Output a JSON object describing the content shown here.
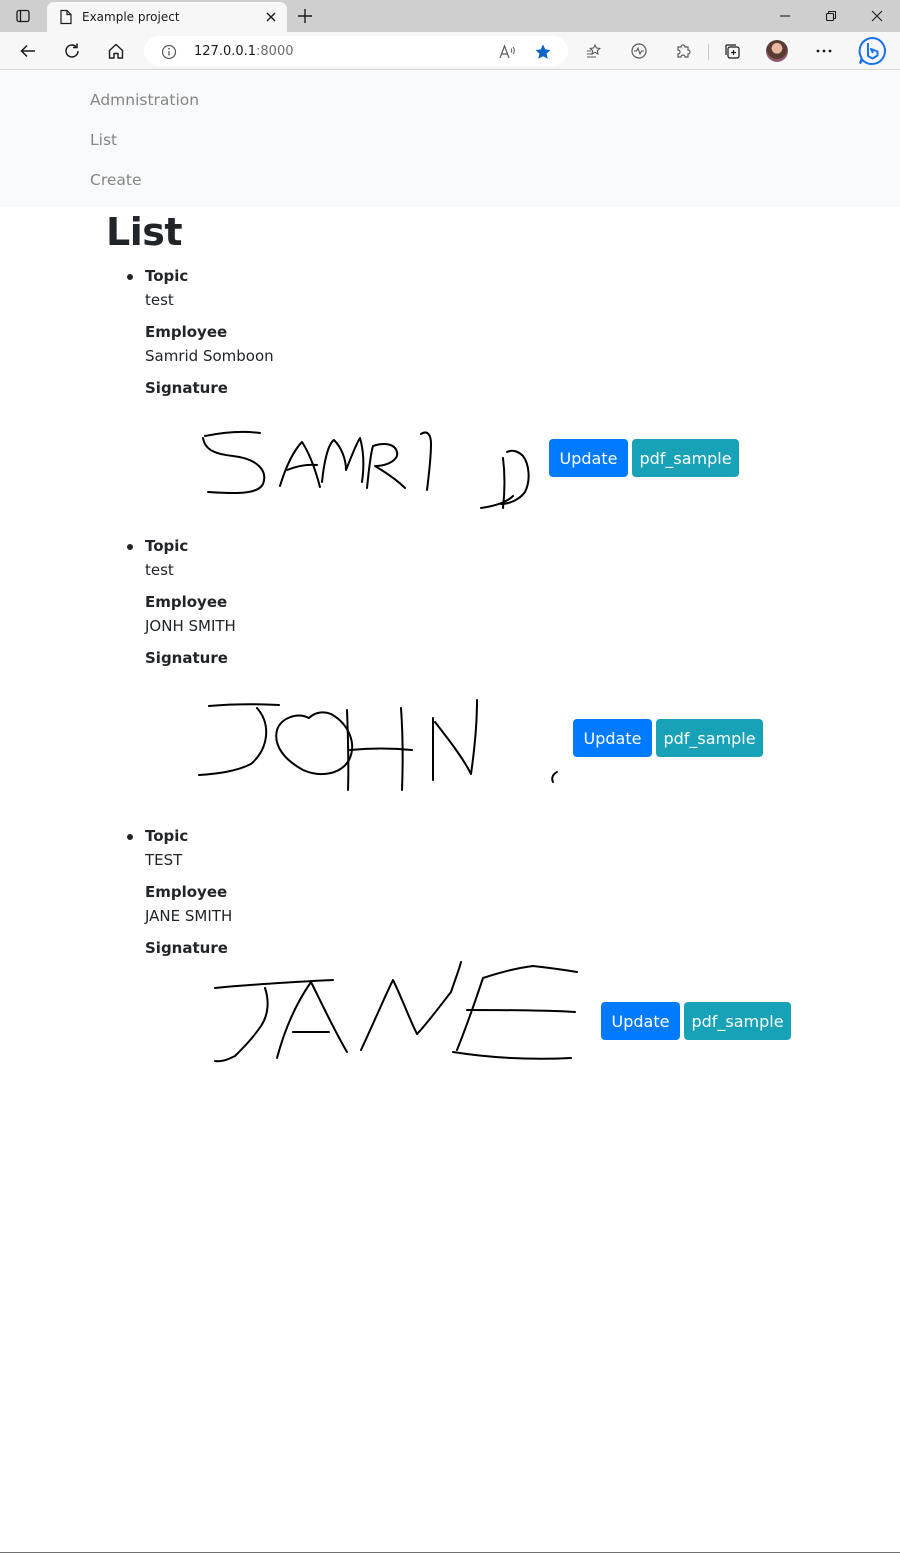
{
  "browser": {
    "tab_title": "Example project",
    "address": {
      "host": "127.0.0.1",
      "port": ":8000"
    },
    "accent_color": "#0a63c9"
  },
  "nav": {
    "items": [
      {
        "label": "Admnistration"
      },
      {
        "label": "List"
      },
      {
        "label": "Create"
      }
    ]
  },
  "page": {
    "title": "List",
    "labels": {
      "topic": "Topic",
      "employee": "Employee",
      "signature": "Signature"
    },
    "entries": [
      {
        "topic": "test",
        "employee": "Samrid Somboon",
        "signature_text": "SAMRID",
        "update_label": "Update",
        "pdf_label": "pdf_sample"
      },
      {
        "topic": "test",
        "employee": "JONH SMITH",
        "signature_text": "JOHN",
        "update_label": "Update",
        "pdf_label": "pdf_sample"
      },
      {
        "topic": "TEST",
        "employee": "JANE SMITH",
        "signature_text": "JANE",
        "update_label": "Update",
        "pdf_label": "pdf_sample"
      }
    ],
    "colors": {
      "primary": "#007bff",
      "info": "#17a2b8",
      "nav_bg": "#f8f9fa"
    }
  }
}
